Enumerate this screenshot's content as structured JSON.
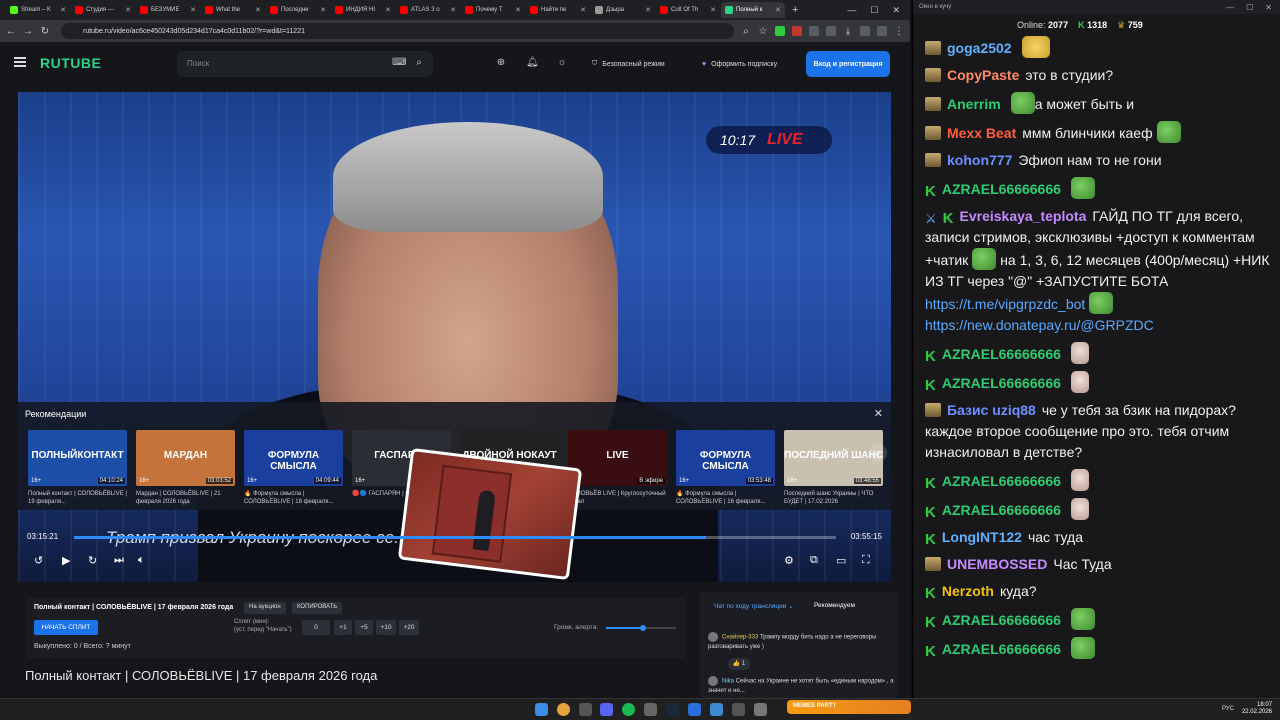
{
  "browser": {
    "tabs": [
      {
        "label": "Stream – K",
        "color": "#53fc18",
        "active": false
      },
      {
        "label": "Студия — ",
        "color": "#ff0000",
        "active": false
      },
      {
        "label": "БЕЗУМИЕ",
        "color": "#ff0000",
        "active": false
      },
      {
        "label": "What the",
        "color": "#ff0000",
        "active": false
      },
      {
        "label": "Последни",
        "color": "#ff0000",
        "active": false
      },
      {
        "label": "ИНДИЯ HI",
        "color": "#ff0000",
        "active": false
      },
      {
        "label": "ATLAS 3 o",
        "color": "#ff0000",
        "active": false
      },
      {
        "label": "Почему T",
        "color": "#ff0000",
        "active": false
      },
      {
        "label": "Найти пе",
        "color": "#ff0000",
        "active": false
      },
      {
        "label": "Дзырa",
        "color": "#999999",
        "active": false
      },
      {
        "label": "Cult Of Th",
        "color": "#ff0000",
        "active": false
      },
      {
        "label": "Полный к",
        "color": "#2fd38b",
        "active": true
      }
    ],
    "url": "rutube.ru/video/ac6ce450243d05d234d17ca4c0d11b02/?r=wd&t=11221"
  },
  "rutube": {
    "logo": "RUTUBE",
    "search_placeholder": "Поиск",
    "safe_mode": "Безопасный режим",
    "subscribe": "Оформить подписку",
    "login": "Вход и регистрация"
  },
  "player": {
    "live_time": "10:17",
    "live_brand": "LIVE",
    "recs_title": "Рекомендации",
    "subtitle": "Трамп призвал Украину поскорее се...                    ов",
    "time_current": "03:15:21",
    "time_total": "03:55:15",
    "progress": 0.83,
    "recs": [
      {
        "cap": "ПОЛНЫЙКОНТАКТ",
        "age": "16+",
        "dur": "04:10:24",
        "title": "Полный контакт | СОЛОВЬЁВLIVE | 19 февраля...",
        "bg": "#1d4fa8"
      },
      {
        "cap": "МАРДАН",
        "age": "16+",
        "dur": "03:03:52",
        "title": "Мардан | СОЛОВЬЁВLIVE | 21 февраля 2026 года",
        "bg": "#c4743a"
      },
      {
        "cap": "ФОРМУЛА СМЫСЛА",
        "age": "16+",
        "dur": "04:09:44",
        "title": "🔥 Формула смысла | СОЛОВЬЁВLIVE | 18 февраля...",
        "bg": "#1b3f9c"
      },
      {
        "cap": "ГАСПАРЯН",
        "age": "16+",
        "dur": "",
        "title": "🔴🔵 ГАСПАРЯН | СОЛОВЬЁВ...",
        "bg": "#2a2d33"
      },
      {
        "cap": "ДВОЙНОЙ НОКАУТ",
        "age": "",
        "dur": "",
        "title": "",
        "bg": "#222"
      },
      {
        "cap": "LIVE",
        "age": "16+",
        "dur": "В эфире",
        "title": "СОЛОВЬЁВ LIVE | Круглосуточный канал",
        "bg": "#3a0d10"
      },
      {
        "cap": "ФОРМУЛА СМЫСЛА",
        "age": "16+",
        "dur": "03:53:48",
        "title": "🔥 Формула смысла | СОЛОВЬЁВLIVE | 16 февраля...",
        "bg": "#1b3f9c"
      },
      {
        "cap": "ПОСЛЕДНИЙ ШАНС",
        "age": "16+",
        "dur": "03:48:55",
        "title": "Последний шанс Украины | ЧТО БУДЕТ | 17.02.2026",
        "bg": "#c9c0b0"
      }
    ]
  },
  "split": {
    "title": "Полный контакт | СОЛОВЬЁВLIVE | 17 февраля 2026 года",
    "auction": "На аукцион",
    "copy": "КОПИРОВАТЬ",
    "start": "НАЧАТЬ СПЛИТ",
    "split_label_1": "Сплит (мин):",
    "split_label_2": "(уст. перед \"Начать\")",
    "value": "0",
    "b1": "+1",
    "b5": "+5",
    "b10": "+10",
    "b20": "+20",
    "done": "Выкуплено: 0 / Всего: ? минут",
    "volume_label": "Громк. алерта:",
    "volume": 0.49
  },
  "video_title": "Полный контакт | СОЛОВЬЁВLIVE | 17 февраля 2026 года",
  "video_chat": {
    "tab1": "Чат по ходу трансляции",
    "tab2": "Рекомендуем",
    "m1_name": "Снайпер-333",
    "m1_text": "Трампу морду бить надо а не переговоры разговаривать уже )",
    "reaction": "👍 1",
    "m2_name": "Nika",
    "m2_text": "Сейчас на Украине не хотят быть «единым народом» , а значит и не..."
  },
  "chat": {
    "window_title": "Окно в кучу",
    "online_label": "Online:",
    "online": "2077",
    "kick_count": "1318",
    "coin_count": "759",
    "messages": [
      {
        "badge": "o",
        "nick": "goga2502",
        "color": "#5fb0ff",
        "text": "",
        "emote": "pepe-face"
      },
      {
        "badge": "o",
        "nick": "CopyPaste",
        "color": "#ff8a65",
        "text": "это в студии?",
        "emote": ""
      },
      {
        "badge": "o",
        "nick": "Anerrim",
        "color": "#2ecc71",
        "text": "а может быть и",
        "emote": "frog",
        "emote_first": true
      },
      {
        "badge": "o",
        "nick": "Mexx Beat",
        "color": "#ff5e3a",
        "text": "ммм блинчики каеф",
        "emote": "frog"
      },
      {
        "badge": "o",
        "nick": "kohon777",
        "color": "#6d8fff",
        "text": "Эфиоп нам то не гони",
        "emote": ""
      },
      {
        "badge": "k",
        "nick": "AZRAEL66666666",
        "color": "#2ecc71",
        "text": "",
        "emote": "frog"
      },
      {
        "badge": "sk",
        "nick": "Evreiskaya_teplota",
        "color": "#c58bff",
        "text": "ГАЙД ПО ТГ для всего, записи стримов, эксклюзивы +доступ к комментам +чатик",
        "text2": "на 1, 3, 6, 12 месяцев (400р/месяц) +НИК ИЗ ТГ через \"@\" +ЗАПУСТИТЕ БОТА",
        "link1": "https://t.me/vipgrpzdc_bot",
        "link2": "https://new.donatepay.ru/@GRPZDC"
      },
      {
        "badge": "k",
        "nick": "AZRAEL66666666",
        "color": "#2ecc71",
        "text": "",
        "emote": "dog"
      },
      {
        "badge": "k",
        "nick": "AZRAEL66666666",
        "color": "#2ecc71",
        "text": "",
        "emote": "dog"
      },
      {
        "badge": "o",
        "nick": "Базис  uziq88",
        "color": "#6d8fff",
        "text": "че у тебя за бзик на пидорах? каждое второе сообщение про это. тебя отчим изнасиловал в детстве?",
        "emote": ""
      },
      {
        "badge": "k",
        "nick": "AZRAEL66666666",
        "color": "#2ecc71",
        "text": "",
        "emote": "dog"
      },
      {
        "badge": "k",
        "nick": "AZRAEL66666666",
        "color": "#2ecc71",
        "text": "",
        "emote": "dog"
      },
      {
        "badge": "k",
        "nick": "LongINT122",
        "color": "#5fb0ff",
        "text": "час туда",
        "emote": ""
      },
      {
        "badge": "o",
        "nick": "UNEMBOSSED",
        "color": "#c58bff",
        "text": "Час Туда",
        "emote": ""
      },
      {
        "badge": "k",
        "nick": "Nerzoth",
        "color": "#f1c40f",
        "text": "куда?",
        "emote": ""
      },
      {
        "badge": "k",
        "nick": "AZRAEL66666666",
        "color": "#2ecc71",
        "text": "",
        "emote": "frog"
      },
      {
        "badge": "k",
        "nick": "AZRAEL66666666",
        "color": "#2ecc71",
        "text": "",
        "emote": "frog"
      }
    ]
  },
  "taskbar": {
    "memes": "MEMES PARTY",
    "lang": "РУС",
    "time": "18:07",
    "date": "22.02.2026"
  }
}
